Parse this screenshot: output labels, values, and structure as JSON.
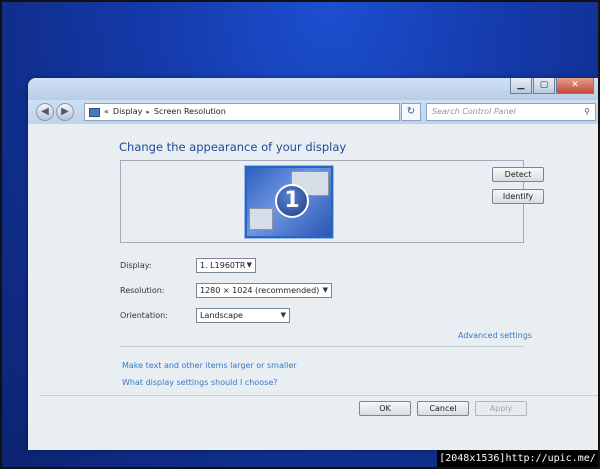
{
  "titlebar": {
    "buttons": {
      "minimize": "▁",
      "maximize": "▢",
      "close": "✕"
    }
  },
  "addressbar": {
    "back_icon": "back-arrow-icon",
    "forward_icon": "forward-arrow-icon",
    "chevrons": "«",
    "crumbs": [
      "Display",
      "Screen Resolution"
    ],
    "separator": "▸",
    "refresh_glyph": "↻",
    "search_placeholder": "Search Control Panel",
    "search_icon_glyph": "⚲"
  },
  "main": {
    "title": "Change the appearance of your display",
    "monitor_number": "1",
    "detect_label": "Detect",
    "identify_label": "Identify",
    "display_label": "Display:",
    "display_value": "1. L1960TR",
    "resolution_label": "Resolution:",
    "resolution_value": "1280 × 1024 (recommended)",
    "orientation_label": "Orientation:",
    "orientation_value": "Landscape",
    "advanced_link": "Advanced settings",
    "link_text_size": "Make text and other items larger or smaller",
    "link_which_settings": "What display settings should I choose?",
    "ok_label": "OK",
    "cancel_label": "Cancel",
    "apply_label": "Apply"
  },
  "watermark": "[2048x1536]http://upic.me/",
  "colors": {
    "desktop": "#1439a8",
    "title_text": "#1d4a9a",
    "link": "#3a78c8",
    "monitor_selected": "#2466c4"
  }
}
